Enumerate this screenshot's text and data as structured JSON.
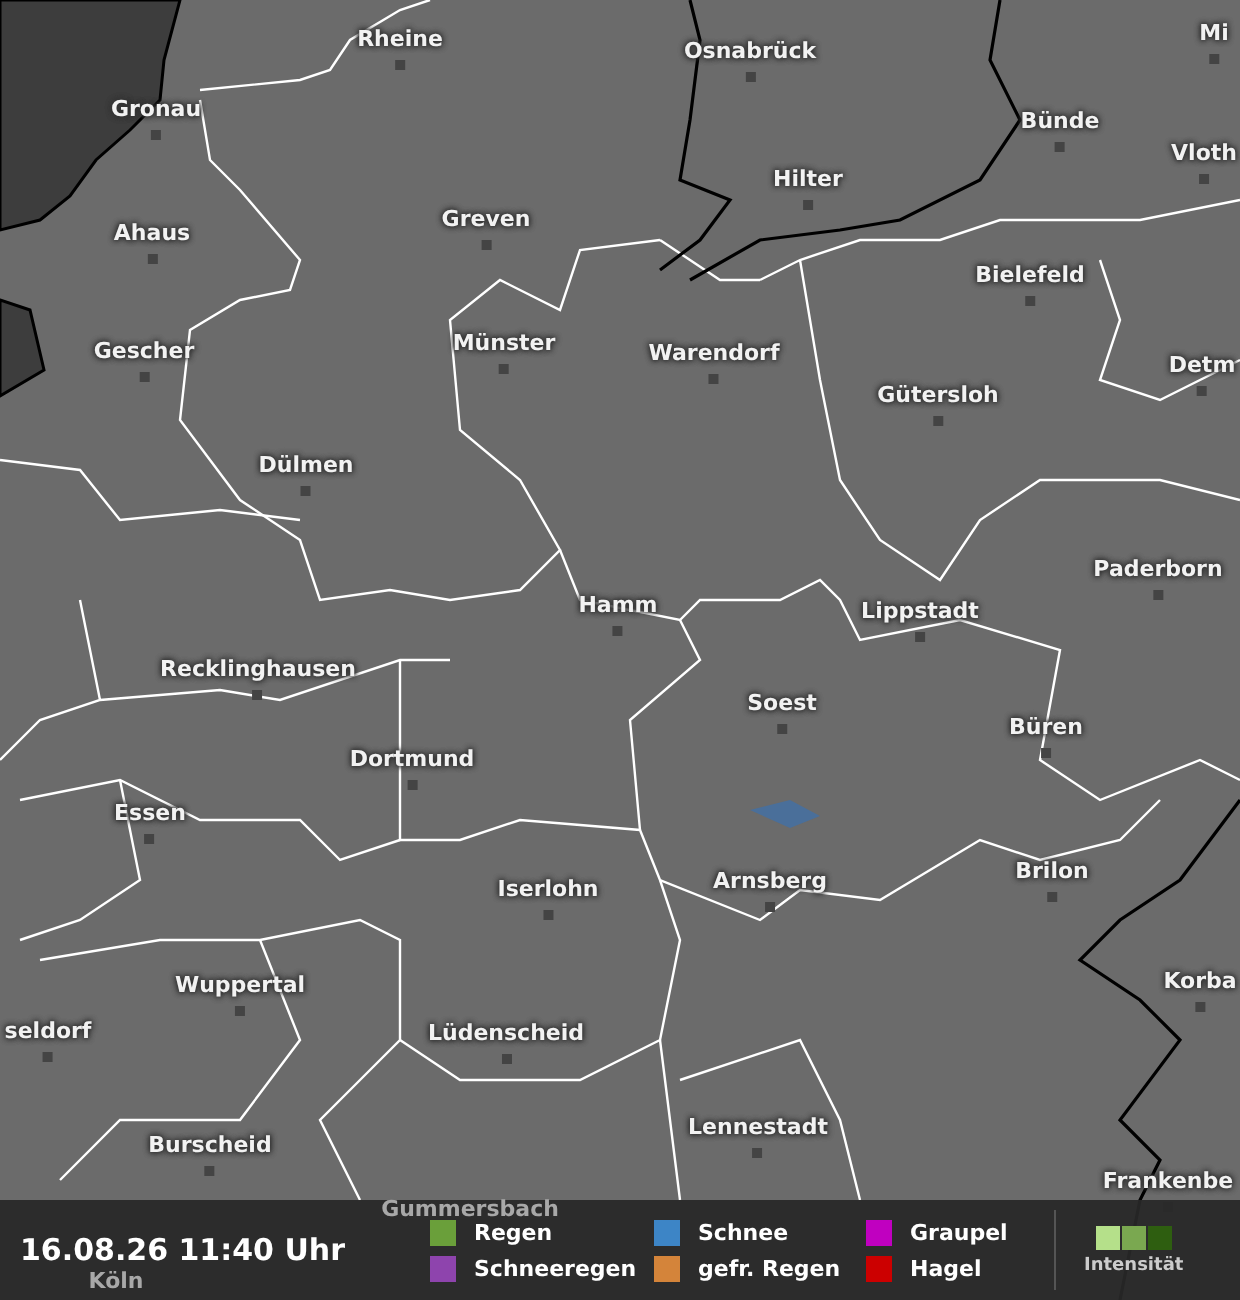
{
  "map": {
    "cities": [
      {
        "name": "Rheine"
      },
      {
        "name": "Osnabrück"
      },
      {
        "name": "Mi"
      },
      {
        "name": "Gronau"
      },
      {
        "name": "Bünde"
      },
      {
        "name": "Vloth"
      },
      {
        "name": "Hilter"
      },
      {
        "name": "Ahaus"
      },
      {
        "name": "Greven"
      },
      {
        "name": "Bielefeld"
      },
      {
        "name": "Gescher"
      },
      {
        "name": "Münster"
      },
      {
        "name": "Warendorf"
      },
      {
        "name": "Gütersloh"
      },
      {
        "name": "Detm"
      },
      {
        "name": "Dülmen"
      },
      {
        "name": "Paderborn"
      },
      {
        "name": "Hamm"
      },
      {
        "name": "Lippstadt"
      },
      {
        "name": "Recklinghausen"
      },
      {
        "name": "Soest"
      },
      {
        "name": "Dortmund"
      },
      {
        "name": "Büren"
      },
      {
        "name": "Essen"
      },
      {
        "name": "Brilon"
      },
      {
        "name": "Iserlohn"
      },
      {
        "name": "Arnsberg"
      },
      {
        "name": "Korba"
      },
      {
        "name": "Wuppertal"
      },
      {
        "name": "Lüdenscheid"
      },
      {
        "name": "seldorf"
      },
      {
        "name": "Burscheid"
      },
      {
        "name": "Lennestadt"
      },
      {
        "name": "Frankenbe"
      },
      {
        "name": "Gummersbach"
      },
      {
        "name": "Köln"
      }
    ]
  },
  "status_bar": {
    "timestamp": "16.08.26 11:40 Uhr",
    "legend": [
      {
        "label": "Regen",
        "color": "#6a9f3a"
      },
      {
        "label": "Schneeregen",
        "color": "#8e44ad"
      },
      {
        "label": "Schnee",
        "color": "#3d85c6"
      },
      {
        "label": "gefr. Regen",
        "color": "#d4843a"
      },
      {
        "label": "Graupel",
        "color": "#c000c0"
      },
      {
        "label": "Hagel",
        "color": "#cc0000"
      }
    ],
    "intensity_label": "Intensität"
  }
}
